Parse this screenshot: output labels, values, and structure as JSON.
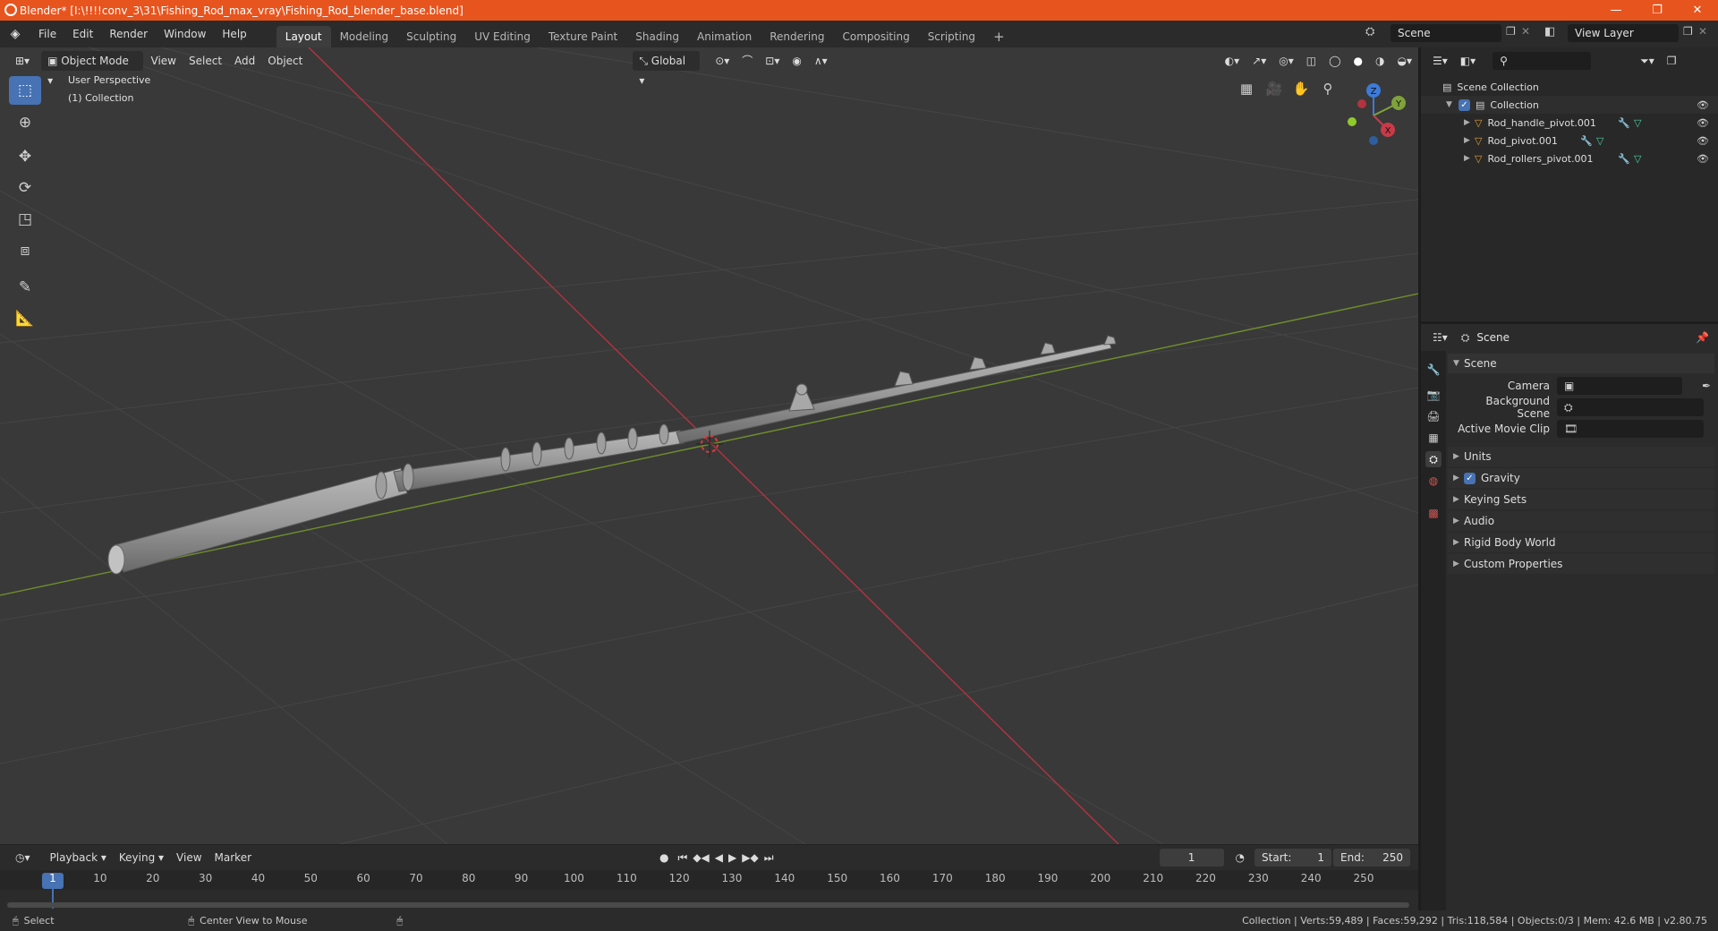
{
  "window": {
    "title": "Blender* [I:\\!!!!conv_3\\31\\Fishing_Rod_max_vray\\Fishing_Rod_blender_base.blend]",
    "minimize": "—",
    "maximize": "❐",
    "close": "✕"
  },
  "menus": [
    "File",
    "Edit",
    "Render",
    "Window",
    "Help"
  ],
  "workspaces": [
    "Layout",
    "Modeling",
    "Sculpting",
    "UV Editing",
    "Texture Paint",
    "Shading",
    "Animation",
    "Rendering",
    "Compositing",
    "Scripting"
  ],
  "scene_field": "Scene",
  "view_layer_field": "View Layer",
  "viewport": {
    "mode": "Object Mode",
    "menus": [
      "View",
      "Select",
      "Add",
      "Object"
    ],
    "transform_orientation": "Global",
    "overlay_text_1": "User Perspective",
    "overlay_text_2": "(1) Collection",
    "gizmo_axes": {
      "x": "X",
      "y": "Y",
      "z": "Z"
    }
  },
  "outliner": {
    "root": "Scene Collection",
    "collection": "Collection",
    "objects": [
      "Rod_handle_pivot.001",
      "Rod_pivot.001",
      "Rod_rollers_pivot.001"
    ]
  },
  "properties": {
    "header": "Scene",
    "panel_title": "Scene",
    "camera_label": "Camera",
    "background_scene_label": "Background Scene",
    "active_movie_clip_label": "Active Movie Clip",
    "sections": [
      "Units",
      "Gravity",
      "Keying Sets",
      "Audio",
      "Rigid Body World",
      "Custom Properties"
    ]
  },
  "timeline": {
    "menus": [
      "Playback",
      "Keying",
      "View",
      "Marker"
    ],
    "current_frame": "1",
    "start_label": "Start:",
    "start_value": "1",
    "end_label": "End:",
    "end_value": "250",
    "ticks": [
      "1",
      "10",
      "20",
      "30",
      "40",
      "50",
      "60",
      "70",
      "80",
      "90",
      "100",
      "110",
      "120",
      "130",
      "140",
      "150",
      "160",
      "170",
      "180",
      "190",
      "200",
      "210",
      "220",
      "230",
      "240",
      "250"
    ]
  },
  "status": {
    "left_action": "Select",
    "mid_action": "Center View to Mouse",
    "stats": "Collection | Verts:59,489 | Faces:59,292 | Tris:118,584 | Objects:0/3 | Mem: 42.6 MB | v2.80.75"
  },
  "colors": {
    "accent": "#4772b3",
    "titlebar": "#e8541e",
    "x_axis": "#c93a48",
    "y_axis": "#7fa23a",
    "z_axis": "#3d7bd9"
  }
}
